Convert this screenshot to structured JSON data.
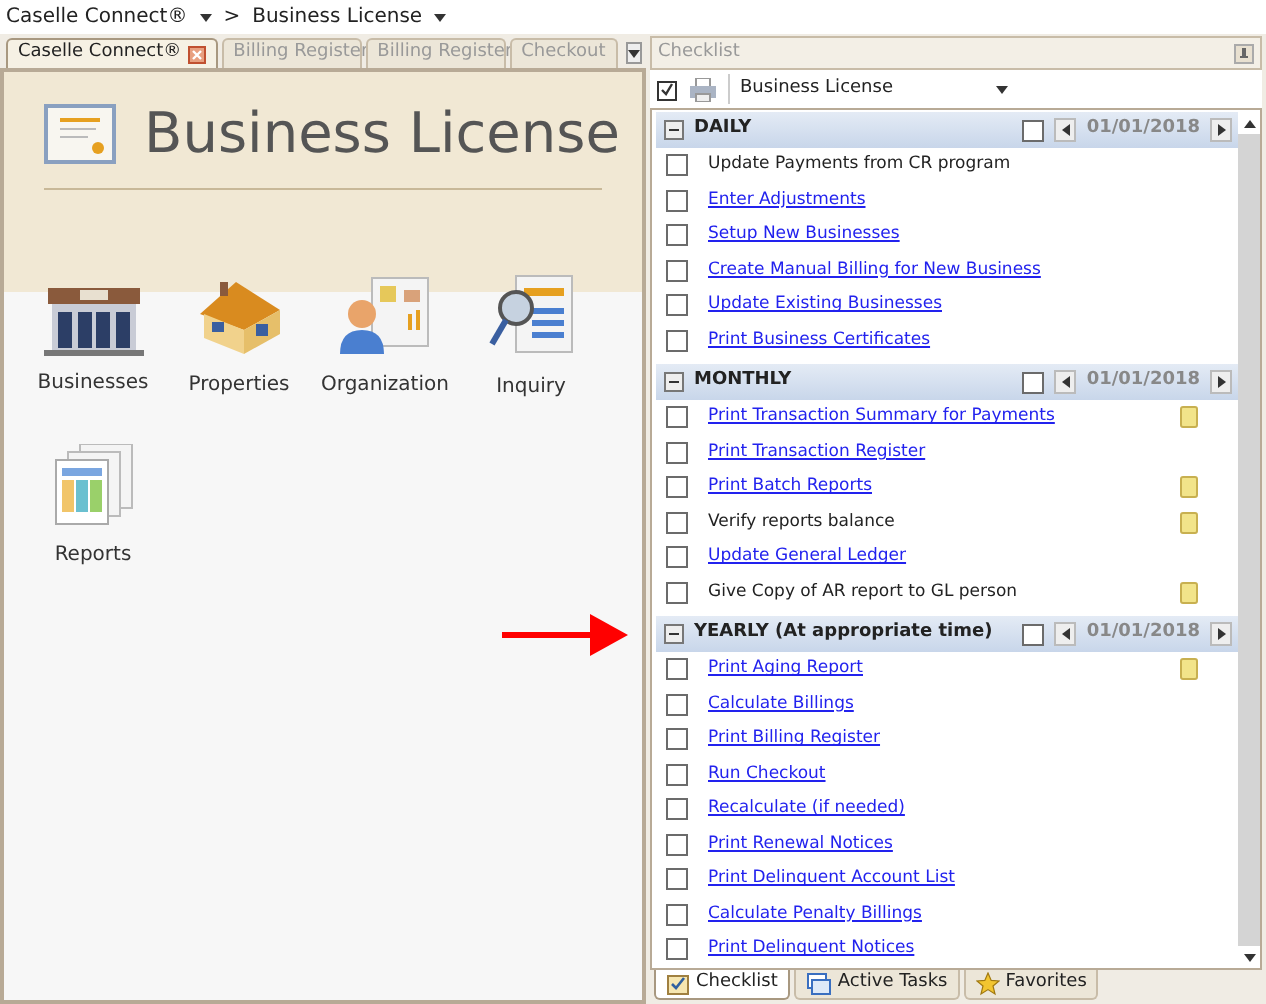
{
  "breadcrumb": {
    "items": [
      "Caselle Connect®",
      "Business License"
    ],
    "separator": ">"
  },
  "tabs": [
    {
      "label": "Caselle Connect®",
      "selected": true,
      "closable": true
    },
    {
      "label": "Billing Register",
      "selected": false,
      "closable": false
    },
    {
      "label": "Billing Register",
      "selected": false,
      "closable": false
    },
    {
      "label": "Checkout",
      "selected": false,
      "closable": false
    }
  ],
  "module": {
    "title": "Business License",
    "items": [
      {
        "label": "Businesses",
        "kind": "store"
      },
      {
        "label": "Properties",
        "kind": "house"
      },
      {
        "label": "Organization",
        "kind": "person"
      },
      {
        "label": "Inquiry",
        "kind": "inquiry"
      },
      {
        "label": "Reports",
        "kind": "reports"
      }
    ]
  },
  "checklist": {
    "title": "Checklist",
    "selector": "Business License",
    "sections": [
      {
        "title": "DAILY",
        "date": "01/01/2018",
        "checked": false,
        "items": [
          {
            "label": "Update Payments from CR program",
            "kind": "plain",
            "checked": false,
            "note": false
          },
          {
            "label": "Enter Adjustments",
            "kind": "link",
            "checked": false,
            "note": false
          },
          {
            "label": "Setup New Businesses",
            "kind": "link",
            "checked": false,
            "note": false
          },
          {
            "label": "Create Manual Billing for New Business",
            "kind": "link",
            "checked": false,
            "note": false
          },
          {
            "label": "Update Existing Businesses",
            "kind": "link",
            "checked": false,
            "note": false
          },
          {
            "label": "Print Business Certificates",
            "kind": "link",
            "checked": false,
            "note": false
          }
        ]
      },
      {
        "title": "MONTHLY",
        "date": "01/01/2018",
        "checked": false,
        "items": [
          {
            "label": "Print Transaction Summary for Payments",
            "kind": "link",
            "checked": false,
            "note": true
          },
          {
            "label": "Print Transaction Register",
            "kind": "link",
            "checked": false,
            "note": false
          },
          {
            "label": "Print Batch Reports",
            "kind": "link",
            "checked": false,
            "note": true
          },
          {
            "label": "Verify reports balance",
            "kind": "plain",
            "checked": false,
            "note": true
          },
          {
            "label": "Update General Ledger",
            "kind": "link",
            "checked": false,
            "note": false
          },
          {
            "label": "Give Copy of AR report to GL person",
            "kind": "plain",
            "checked": false,
            "note": true
          }
        ]
      },
      {
        "title": "YEARLY (At appropriate time)",
        "date": "01/01/2018",
        "checked": false,
        "items": [
          {
            "label": "Print Aging Report",
            "kind": "link",
            "checked": false,
            "note": true
          },
          {
            "label": "Calculate Billings",
            "kind": "link",
            "checked": false,
            "note": false
          },
          {
            "label": "Print Billing Register",
            "kind": "link",
            "checked": false,
            "note": false
          },
          {
            "label": "Run Checkout",
            "kind": "link",
            "checked": false,
            "note": false
          },
          {
            "label": "Recalculate (if needed)",
            "kind": "link",
            "checked": false,
            "note": false
          },
          {
            "label": "Print Renewal Notices",
            "kind": "link",
            "checked": false,
            "note": false
          },
          {
            "label": "Print Delinquent Account List",
            "kind": "link",
            "checked": false,
            "note": false
          },
          {
            "label": "Calculate Penalty Billings",
            "kind": "link",
            "checked": false,
            "note": false
          },
          {
            "label": "Print Delinquent Notices",
            "kind": "link",
            "checked": false,
            "note": false
          }
        ]
      }
    ],
    "bottom_tabs": [
      {
        "label": "Checklist",
        "selected": true,
        "kind": "checklist"
      },
      {
        "label": "Active Tasks",
        "selected": false,
        "kind": "tasks"
      },
      {
        "label": "Favorites",
        "selected": false,
        "kind": "star"
      }
    ]
  }
}
